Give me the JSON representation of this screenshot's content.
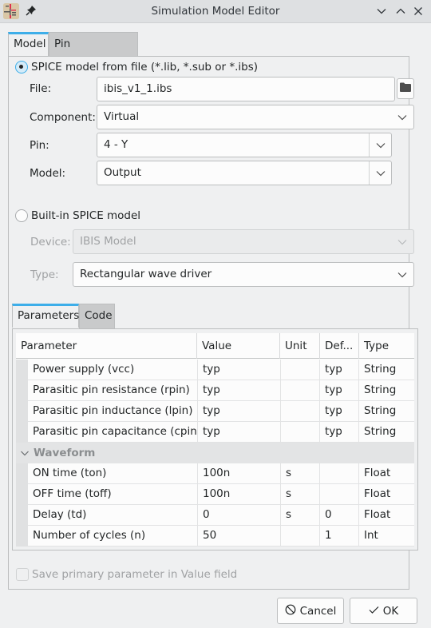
{
  "window": {
    "title": "Simulation Model Editor",
    "controls": [
      "minimize",
      "maximize",
      "close"
    ]
  },
  "tabs": [
    {
      "label": "Model",
      "active": true
    },
    {
      "label": "Pin Assignments",
      "active": false
    }
  ],
  "spice_from_file": {
    "radio_label": "SPICE model from file (*.lib, *.sub or *.ibs)",
    "selected": true,
    "file_label": "File:",
    "file_value": "ibis_v1_1.ibs",
    "component_label": "Component:",
    "component_value": "Virtual",
    "pin_label": "Pin:",
    "pin_value": "4 - Y",
    "model_label": "Model:",
    "model_value": "Output"
  },
  "builtin": {
    "radio_label": "Built-in SPICE model",
    "selected": false,
    "device_label": "Device:",
    "device_value": "IBIS Model",
    "type_label": "Type:",
    "type_value": "Rectangular wave driver"
  },
  "subtabs": [
    {
      "label": "Parameters",
      "active": true
    },
    {
      "label": "Code",
      "active": false
    }
  ],
  "table": {
    "columns": [
      "Parameter",
      "Value",
      "Unit",
      "Def...",
      "Type"
    ],
    "rows": [
      {
        "param": "Power supply (vcc)",
        "value": "typ",
        "unit": "",
        "default": "typ",
        "type": "String"
      },
      {
        "param": "Parasitic pin resistance (rpin)",
        "value": "typ",
        "unit": "",
        "default": "typ",
        "type": "String"
      },
      {
        "param": "Parasitic pin inductance (lpin)",
        "value": "typ",
        "unit": "",
        "default": "typ",
        "type": "String"
      },
      {
        "param": "Parasitic pin capacitance (cpin)",
        "value": "typ",
        "unit": "",
        "default": "typ",
        "type": "String"
      }
    ],
    "group": {
      "label": "Waveform",
      "expanded": true
    },
    "group_rows": [
      {
        "param": "ON time (ton)",
        "value": "100n",
        "unit": "s",
        "default": "",
        "type": "Float"
      },
      {
        "param": "OFF time (toff)",
        "value": "100n",
        "unit": "s",
        "default": "",
        "type": "Float"
      },
      {
        "param": "Delay (td)",
        "value": "0",
        "unit": "s",
        "default": "0",
        "type": "Float"
      },
      {
        "param": "Number of cycles (n)",
        "value": "50",
        "unit": "",
        "default": "1",
        "type": "Int"
      }
    ]
  },
  "save_primary": {
    "label": "Save primary parameter in Value field",
    "checked": false,
    "enabled": false
  },
  "buttons": {
    "cancel": "Cancel",
    "ok": "OK"
  },
  "colors": {
    "accent": "#3daee9",
    "background": "#eff0f1",
    "titlebar": "#dee0e2"
  }
}
